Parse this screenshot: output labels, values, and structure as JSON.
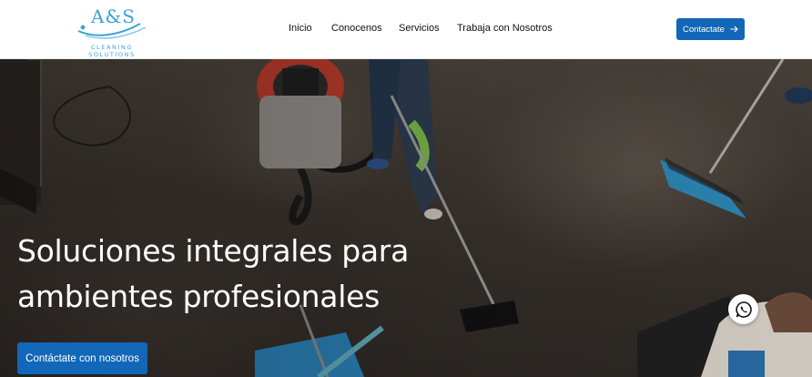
{
  "brand": {
    "mark": "A&S",
    "subtitle": "CLEANING SOLUTIONS",
    "color": "#3aa3d6"
  },
  "nav": {
    "items": [
      {
        "label": "Inicio"
      },
      {
        "label": "Conocenos"
      },
      {
        "label": "Servicios"
      },
      {
        "label": "Trabaja con Nosotros"
      }
    ]
  },
  "header_cta": {
    "label": "Contactate",
    "icon": "arrow-right-icon"
  },
  "hero": {
    "title": "Soluciones integrales para ambientes profesionales",
    "cta_label": "Contáctate con nosotros",
    "background": "photo of cleaning staff with vacuum and mops on concrete floor"
  },
  "floating": {
    "icon": "whatsapp-icon"
  },
  "colors": {
    "primary": "#1267b8",
    "header_bg": "#ffffff",
    "text": "#111111"
  }
}
